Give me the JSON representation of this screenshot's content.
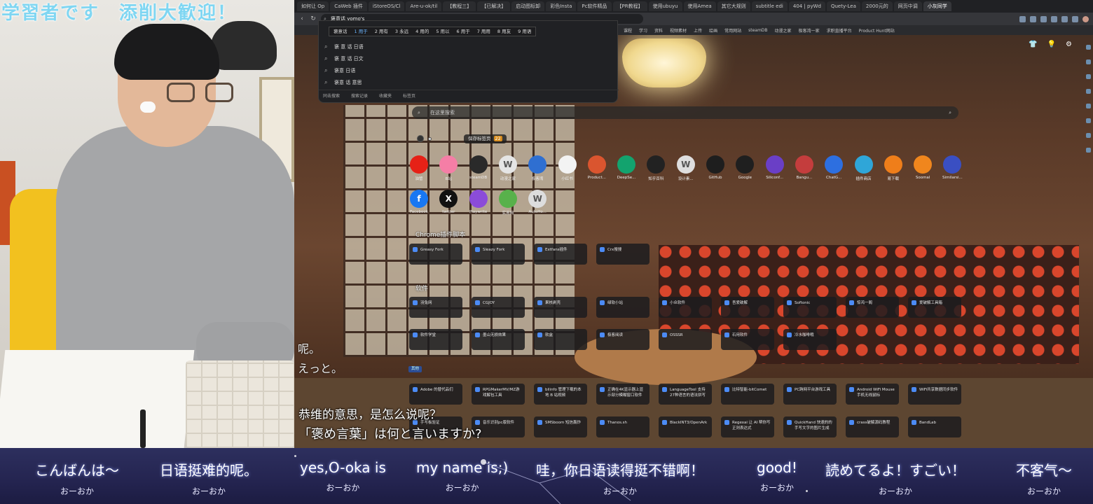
{
  "overlay": {
    "title": "学習者です　添削大歓迎！",
    "subtitle_cn": "恭维的意思，是怎么说呢？",
    "subtitle_jp": "「褒め言葉」は何と言いますか?",
    "left_caption_1": "呢。",
    "left_caption_2": "えっと。"
  },
  "browser": {
    "tabs": [
      "如何让 Op",
      "CaWeb 插件",
      "iStoreOS/Cl",
      "Are-u-ok/til",
      "【教程三】",
      "【已解决】",
      "启动图标卸",
      "彩色Insta",
      "Pc软件精品",
      "【PR教程】",
      "使用ubuyu",
      "使用Amea",
      "其它大规则",
      "subtitle edi",
      "404 | pyWd",
      "Quety-Lea",
      "2000元的",
      "网页中调",
      "小灰同学"
    ],
    "active_tab": 18,
    "address": "褒意话 yomo's",
    "bookmarks": [
      "课程",
      "学习",
      "资料",
      "视频素材",
      "上传",
      "绘画",
      "常用网站",
      "steamDB",
      "动漫之家",
      "极客湾一家",
      "求职直播平台",
      "Product Hunt网站"
    ]
  },
  "dropdown": {
    "ime_candidates": [
      "1 用于",
      "2 用有",
      "3 永远",
      "4 用的",
      "5 用以",
      "6 用于",
      "7 用用",
      "8 用友",
      "9 用语"
    ],
    "ime_prefix": "褒意话",
    "suggestions": [
      "褒 意 话 日语",
      "褒 意 话 日文",
      "褒意 日语",
      "褒意 话 意思"
    ],
    "footer": [
      "同击搜索",
      "搜索记录",
      "收藏夹",
      "标签页"
    ]
  },
  "newtab": {
    "search_placeholder": "在这里搜索",
    "save_label": "保存标签页",
    "save_count": "22",
    "apps_row1": [
      {
        "label": "油管",
        "icon": "youtube-icon",
        "color": "#e62117"
      },
      {
        "label": "B站",
        "icon": "bilibili-icon",
        "color": "#f57ea6"
      },
      {
        "label": "steamDB",
        "icon": "steamdb-icon",
        "color": "#2a2a2a"
      },
      {
        "label": "动漫之家",
        "icon": "w-icon",
        "color": "#e5e5e5"
      },
      {
        "label": "极客湾",
        "icon": "geek-icon",
        "color": "#2f6fd1"
      },
      {
        "label": "小红书",
        "icon": "xhs-icon",
        "color": "#f3f3f3"
      },
      {
        "label": "Product...",
        "icon": "producthunt-icon",
        "color": "#da552f"
      },
      {
        "label": "DeepSe...",
        "icon": "deepseek-icon",
        "color": "#13a36e"
      },
      {
        "label": "知乎百科",
        "icon": "openai-icon",
        "color": "#222222"
      },
      {
        "label": "设计素...",
        "icon": "w-icon",
        "color": "#dedede"
      },
      {
        "label": "GitHub",
        "icon": "github-icon",
        "color": "#1e1e1e"
      },
      {
        "label": "Google",
        "icon": "google-icon",
        "color": "#1f1f1f"
      },
      {
        "label": "Siliconf...",
        "icon": "silicon-icon",
        "color": "#6a3fc6"
      },
      {
        "label": "Bangu...",
        "icon": "bangumi-icon",
        "color": "#c43d3d"
      },
      {
        "label": "ChatG...",
        "icon": "chat-icon",
        "color": "#2d6fe0"
      },
      {
        "label": "插件商店",
        "icon": "store-icon",
        "color": "#2fa6d8"
      },
      {
        "label": "易下载",
        "icon": "download-icon",
        "color": "#ef7e1a"
      },
      {
        "label": "Soomal",
        "icon": "soomal-icon",
        "color": "#f0861d"
      },
      {
        "label": "Similarsi...",
        "icon": "similar-icon",
        "color": "#3a4fc2"
      }
    ],
    "apps_row2": [
      {
        "label": "Facebook",
        "icon": "facebook-icon",
        "color": "#1877f2"
      },
      {
        "label": "twitter",
        "icon": "x-icon",
        "color": "#111111"
      },
      {
        "label": "Playwrite",
        "icon": "playwrite-icon",
        "color": "#8b4cd9"
      },
      {
        "label": "实用网",
        "icon": "util-icon",
        "color": "#58b14b"
      },
      {
        "label": "AutoHo...",
        "icon": "w-icon",
        "color": "#dddddd"
      }
    ],
    "section1": "Chrome插件脚本",
    "cards1": [
      "Greasy Fork",
      "Sleazy Fork",
      "Extfans插件",
      "Crx搜搜"
    ],
    "section2": "软件",
    "cards2": [
      "羽兔网",
      "CGJOY",
      "果核剥壳",
      "绿软小站",
      "小众软件",
      "吾爱破解",
      "Softonic",
      "惊鸿一阁",
      "爱破解工具箱",
      "软件学堂",
      "墨山无损效果",
      "软盒",
      "极客阅读",
      "OSSSR",
      "石用软件",
      "冷水咖啡哦"
    ],
    "tag": "其他",
    "cards3": [
      "Adobe 的替代品们",
      "RPGMakerMV/MZ游戏解包工具",
      "bilinfo 管理下载的本地 B 站视频",
      "正确在4K显示器上显示部分模糊窗口软件",
      "LanguageTool 支持27种语言的语法拼写",
      "比特智能-bitComet",
      "PC跨网平台游戏工具",
      "Android WiFi Mouse手机无线鼠标",
      "WiFi共享数据同步软件",
      "手写板验证",
      "音乐识别pc版软件",
      "SMSboom 短信轰炸",
      "Thanos.sh",
      "BlackINT3/OpenArk",
      "Regexai 让 AI 帮你写正则表达式",
      "QuickHand 快速的的手写文字的图片生成",
      "crass破解源码教程",
      "BandLab"
    ]
  },
  "chat": [
    {
      "text": "こんばんは～",
      "user": "おーおか"
    },
    {
      "text": "日语挺难的呢。",
      "user": "おーおか"
    },
    {
      "text": "yes,O-oka is",
      "user": "おーおか"
    },
    {
      "text": "my name is;)",
      "user": "おーおか"
    },
    {
      "text": "哇，你日语读得挺不错啊！",
      "user": "おーおか"
    },
    {
      "text": "good!",
      "user": "おーおか"
    },
    {
      "text": "読めてるよ！すごい！",
      "user": "おーおか"
    },
    {
      "text": "不客气～",
      "user": "おーおか"
    }
  ]
}
